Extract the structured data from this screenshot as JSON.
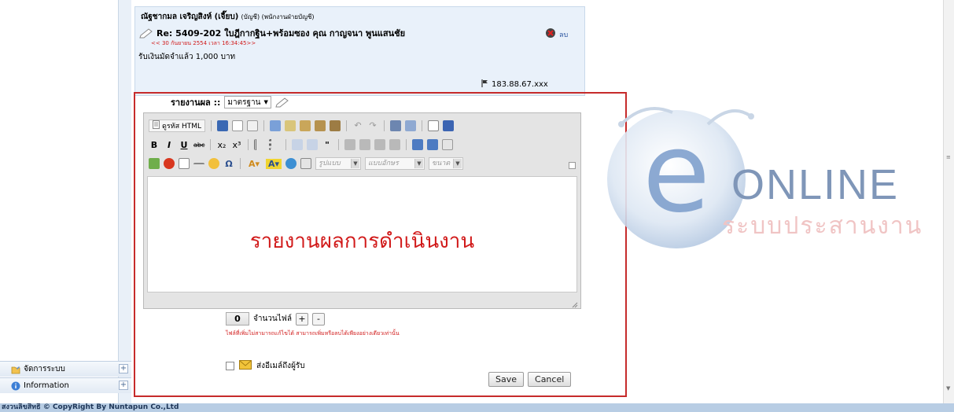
{
  "sidebar": {
    "items": [
      {
        "label": "จัดการระบบ",
        "icon": "folder-icon"
      },
      {
        "label": "Information",
        "icon": "info-icon"
      }
    ],
    "expand_symbol": "+"
  },
  "comment": {
    "author": "ณัฐชากมล เจริญสิงห์ (เจี๊ยบ)",
    "author_meta": "(บัญชี) (พนักงานฝ่ายบัญชี)",
    "subject": "Re: 5409-202 ใบฎีกากฐิน+พร้อมซอง คุณ กาญจนา พูนแสนชัย",
    "date": "<< 30 กันยายน 2554 เวลา 16:34:45>>",
    "body": "รับเงินมัดจำแล้ว 1,000 บาท",
    "delete_label": "ลบ",
    "ip": "183.88.67.xxx"
  },
  "report": {
    "label": "รายงานผล ::",
    "type_selected": "มาตรฐาน"
  },
  "toolbar": {
    "source_label": "ดูรหัส HTML",
    "style_placeholder": "รูปแบบ",
    "font_placeholder": "แบบอักษร",
    "size_placeholder": "ขนาด"
  },
  "editor": {
    "content": "รายงานผลการดำเนินงาน"
  },
  "attach": {
    "count": "0",
    "label": "จำนวนไฟล์",
    "plus": "+",
    "minus": "-",
    "note": "ไฟล์ที่เพิ่มไม่สามารถแก้ไขได้ สามารถเพิ่มหรือลบได้เพียงอย่างเดียวเท่านั้น"
  },
  "email": {
    "label": "ส่งอีเมล์ถึงผู้รับ",
    "checked": false
  },
  "actions": {
    "save": "Save",
    "cancel": "Cancel"
  },
  "watermark": {
    "brand": "ONLINE",
    "tagline": "ระบบประสานงาน"
  },
  "footer": {
    "text": "สงวนลิขสิทธิ์ © CopyRight By Nuntapun Co.,Ltd"
  },
  "colors": {
    "frame": "#c62b2b",
    "editor_text": "#d11a1a",
    "watermark_blue": "#6a8fc0",
    "watermark_tagline": "#f0c4c4"
  }
}
